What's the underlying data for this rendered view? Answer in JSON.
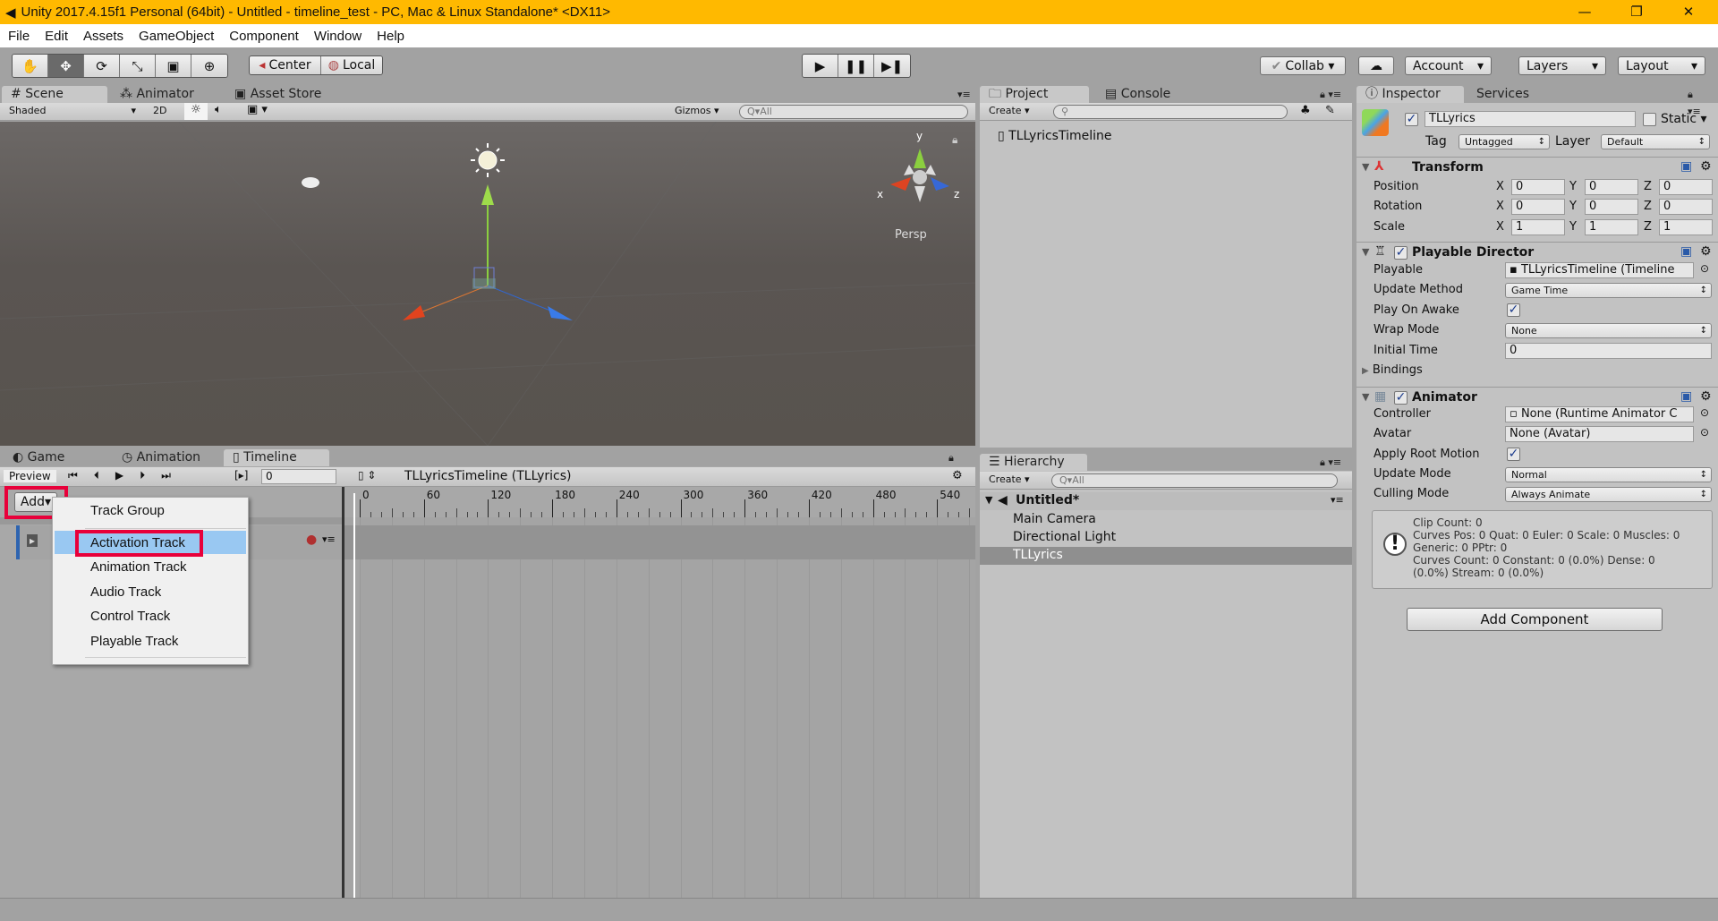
{
  "window": {
    "title": "Unity 2017.4.15f1 Personal (64bit) - Untitled - timeline_test - PC, Mac & Linux Standalone* <DX11>",
    "controls": [
      "minimize",
      "restore",
      "close"
    ]
  },
  "menu": [
    "File",
    "Edit",
    "Assets",
    "GameObject",
    "Component",
    "Window",
    "Help"
  ],
  "toolbar": {
    "tools": [
      "hand-icon",
      "move-icon",
      "rotate-icon",
      "scale-icon",
      "rect-icon",
      "transform-icon"
    ],
    "active_tool": "move-icon",
    "pivot": "Center",
    "space": "Local",
    "collab": "Collab",
    "account": "Account",
    "layers": "Layers",
    "layout": "Layout"
  },
  "scene": {
    "tabs": [
      "Scene",
      "Animator",
      "Asset Store"
    ],
    "active_tab": "Scene",
    "shading": "Shaded",
    "mode_2d": "2D",
    "gizmos": "Gizmos",
    "search_placeholder": "All",
    "persp": "Persp",
    "axes": {
      "x": "x",
      "y": "y",
      "z": "z"
    },
    "sky_color": "#6a6662",
    "ground_color": "#59544f"
  },
  "project": {
    "tabs": [
      "Project",
      "Console"
    ],
    "create": "Create",
    "items": [
      "TLLyricsTimeline"
    ]
  },
  "inspector": {
    "tabs": [
      "Inspector",
      "Services"
    ],
    "object_name": "TLLyrics",
    "active": true,
    "static_label": "Static",
    "static": false,
    "tag_label": "Tag",
    "tag": "Untagged",
    "layer_label": "Layer",
    "layer": "Default",
    "transform": {
      "title": "Transform",
      "rows": [
        {
          "label": "Position",
          "x": "0",
          "y": "0",
          "z": "0"
        },
        {
          "label": "Rotation",
          "x": "0",
          "y": "0",
          "z": "0"
        },
        {
          "label": "Scale",
          "x": "1",
          "y": "1",
          "z": "1"
        }
      ]
    },
    "playable_director": {
      "title": "Playable Director",
      "playable_label": "Playable",
      "playable": "TLLyricsTimeline (Timeline",
      "update_method_label": "Update Method",
      "update_method": "Game Time",
      "play_on_awake_label": "Play On Awake",
      "play_on_awake": true,
      "wrap_mode_label": "Wrap Mode",
      "wrap_mode": "None",
      "initial_time_label": "Initial Time",
      "initial_time": "0",
      "bindings": "Bindings"
    },
    "animator": {
      "title": "Animator",
      "controller_label": "Controller",
      "controller": "None (Runtime Animator C",
      "avatar_label": "Avatar",
      "avatar": "None (Avatar)",
      "apply_root_motion_label": "Apply Root Motion",
      "apply_root_motion": true,
      "update_mode_label": "Update Mode",
      "update_mode": "Normal",
      "culling_mode_label": "Culling Mode",
      "culling_mode": "Always Animate",
      "info": [
        "Clip Count: 0",
        "Curves Pos: 0 Quat: 0 Euler: 0 Scale: 0 Muscles: 0",
        "Generic: 0 PPtr: 0",
        "Curves Count: 0 Constant: 0 (0.0%) Dense: 0",
        "(0.0%) Stream: 0 (0.0%)"
      ]
    },
    "add_component": "Add Component"
  },
  "lower": {
    "tabs": [
      "Game",
      "Animation",
      "Timeline"
    ],
    "active_tab": "Timeline",
    "preview": "Preview",
    "frame": "0",
    "timeline_name": "TLLyricsTimeline (TLLyrics)",
    "add": "Add",
    "ruler": [
      "0",
      "60",
      "120",
      "180",
      "240",
      "300",
      "360",
      "420",
      "480",
      "540"
    ],
    "add_menu": {
      "items": [
        "Track Group",
        "Activation Track",
        "Animation Track",
        "Audio Track",
        "Control Track",
        "Playable Track"
      ],
      "highlighted": "Activation Track"
    },
    "highlight_color": "#e8003a"
  },
  "hierarchy": {
    "tab": "Hierarchy",
    "create": "Create",
    "search_placeholder": "All",
    "scene": "Untitled*",
    "items": [
      "Main Camera",
      "Directional Light",
      "TLLyrics"
    ],
    "selected": "TLLyrics"
  }
}
